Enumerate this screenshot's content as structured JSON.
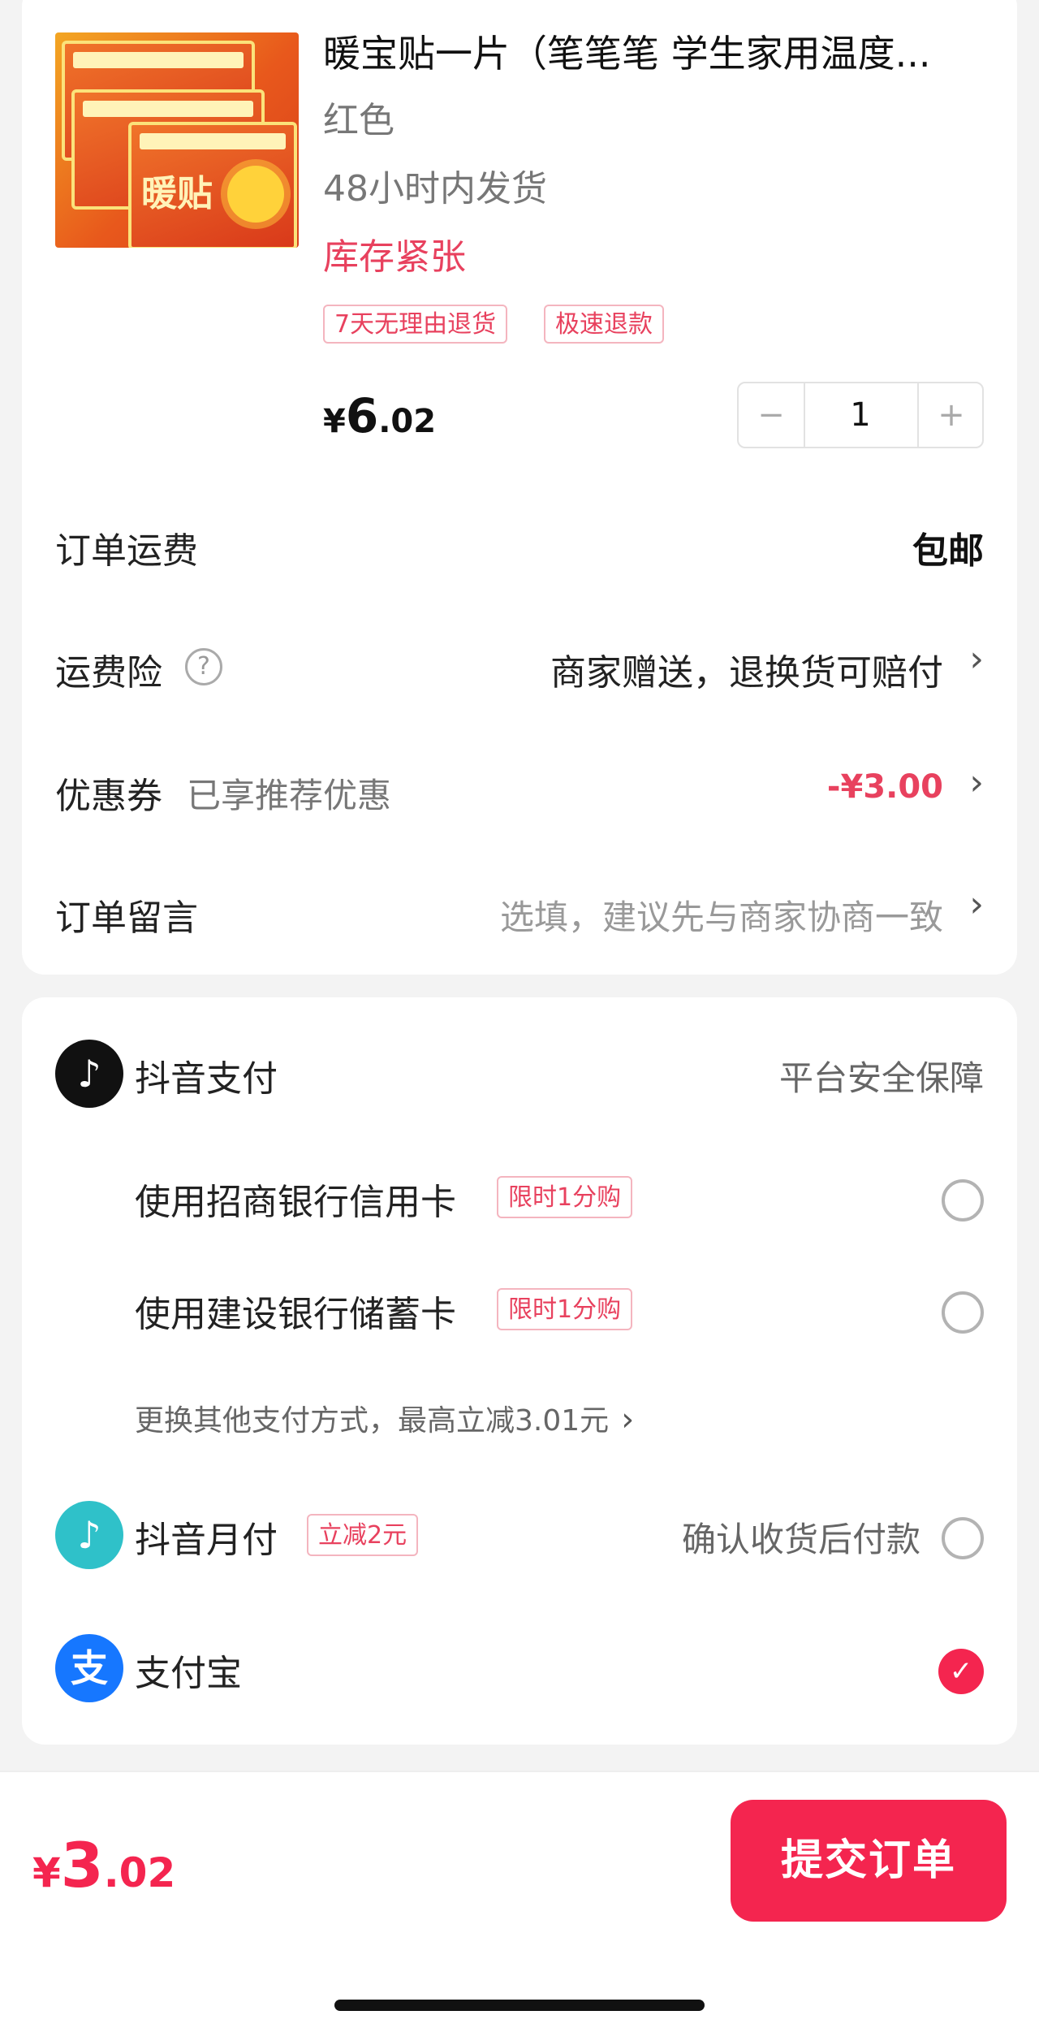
{
  "product": {
    "title": "暖宝贴一片（笔笔笔 学生家用温度...",
    "variant": "红色",
    "shipping_time": "48小时内发货",
    "stock_status": "库存紧张",
    "tags": [
      "7天无理由退货",
      "极速退款"
    ],
    "price_symbol": "¥",
    "price_int": "6",
    "price_dec": ".02",
    "quantity": "1",
    "minus": "−",
    "plus": "+",
    "image_text": "暖贴"
  },
  "order": {
    "shipping_fee_label": "订单运费",
    "shipping_fee_value": "包邮",
    "insurance_label": "运费险",
    "insurance_help": "?",
    "insurance_value": "商家赠送，退换货可赔付",
    "coupon_label": "优惠券",
    "coupon_sub": "已享推荐优惠",
    "coupon_value": "-¥3.00",
    "message_label": "订单留言",
    "message_placeholder": "选填，建议先与商家协商一致",
    "chevron": "›"
  },
  "payment": {
    "douyin_pay": "抖音支付",
    "douyin_pay_note": "平台安全保障",
    "options": [
      {
        "label": "使用招商银行信用卡",
        "badge": "限时1分购"
      },
      {
        "label": "使用建设银行储蓄卡",
        "badge": "限时1分购"
      }
    ],
    "more_methods": "更换其他支付方式，最高立减3.01元",
    "douyin_monthly": "抖音月付",
    "douyin_monthly_badge": "立减2元",
    "douyin_monthly_note": "确认收货后付款",
    "alipay": "支付宝",
    "alipay_icon_char": "支",
    "check": "✓"
  },
  "footer": {
    "total_symbol": "¥",
    "total_int": "3",
    "total_dec": ".02",
    "submit": "提交订单"
  },
  "colors": {
    "accent": "#f4254f",
    "price_red": "#e8415e",
    "douyin_black": "#111111",
    "douyin_cyan": "#2fc1c9",
    "alipay_blue": "#1677ff"
  }
}
